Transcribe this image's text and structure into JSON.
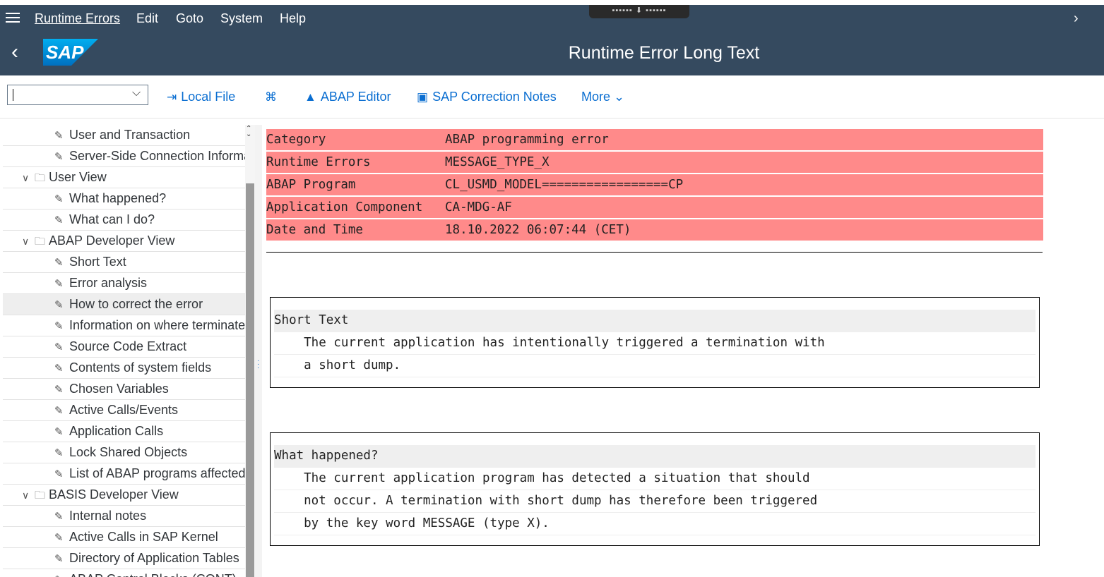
{
  "menu": {
    "items": [
      {
        "label": "Runtime Errors"
      },
      {
        "label": "Edit"
      },
      {
        "label": "Goto"
      },
      {
        "label": "System"
      },
      {
        "label": "Help"
      }
    ]
  },
  "header": {
    "logo_text": "SAP",
    "title": "Runtime Error Long Text"
  },
  "toolbar": {
    "combo_value": "",
    "local_file": "Local File",
    "abap_editor": "ABAP Editor",
    "correction_notes": "SAP Correction Notes",
    "more": "More"
  },
  "tree": {
    "items": [
      {
        "label": "User and Transaction",
        "type": "leaf"
      },
      {
        "label": "Server-Side Connection Informa",
        "type": "leaf"
      },
      {
        "label": "User View",
        "type": "folder"
      },
      {
        "label": "What happened?",
        "type": "leaf"
      },
      {
        "label": "What can I do?",
        "type": "leaf"
      },
      {
        "label": "ABAP Developer View",
        "type": "folder"
      },
      {
        "label": "Short Text",
        "type": "leaf"
      },
      {
        "label": "Error analysis",
        "type": "leaf"
      },
      {
        "label": "How to correct the error",
        "type": "leaf",
        "selected": true
      },
      {
        "label": "Information on where terminate",
        "type": "leaf"
      },
      {
        "label": "Source Code Extract",
        "type": "leaf"
      },
      {
        "label": "Contents of system fields",
        "type": "leaf"
      },
      {
        "label": "Chosen Variables",
        "type": "leaf"
      },
      {
        "label": "Active Calls/Events",
        "type": "leaf"
      },
      {
        "label": "Application Calls",
        "type": "leaf"
      },
      {
        "label": "Lock Shared Objects",
        "type": "leaf"
      },
      {
        "label": "List of ABAP programs affected",
        "type": "leaf"
      },
      {
        "label": "BASIS Developer View",
        "type": "folder"
      },
      {
        "label": "Internal notes",
        "type": "leaf"
      },
      {
        "label": "Active Calls in SAP Kernel",
        "type": "leaf"
      },
      {
        "label": "Directory of Application Tables",
        "type": "leaf"
      },
      {
        "label": "ABAP Control Blocks (CONT)",
        "type": "leaf"
      }
    ]
  },
  "error_header": {
    "rows": [
      {
        "key": "Category",
        "value": "ABAP programming error"
      },
      {
        "key": "Runtime Errors",
        "value": "MESSAGE_TYPE_X"
      },
      {
        "key": "ABAP Program",
        "value": "CL_USMD_MODEL=================CP"
      },
      {
        "key": "Application Component",
        "value": "CA-MDG-AF"
      },
      {
        "key": "Date and Time",
        "value": "18.10.2022 06:07:44 (CET)"
      }
    ]
  },
  "short_text": {
    "heading": "Short Text",
    "lines": [
      "    The current application has intentionally triggered a termination with",
      "    a short dump."
    ]
  },
  "what_happened": {
    "heading": "What happened?",
    "lines": [
      "    The current application program has detected a situation that should",
      "    not occur. A termination with short dump has therefore been triggered",
      "    by the key word MESSAGE (type X)."
    ]
  },
  "colors": {
    "shell": "#354a5f",
    "header_highlight": "#ff8a8a",
    "link": "#0a6ed1"
  }
}
